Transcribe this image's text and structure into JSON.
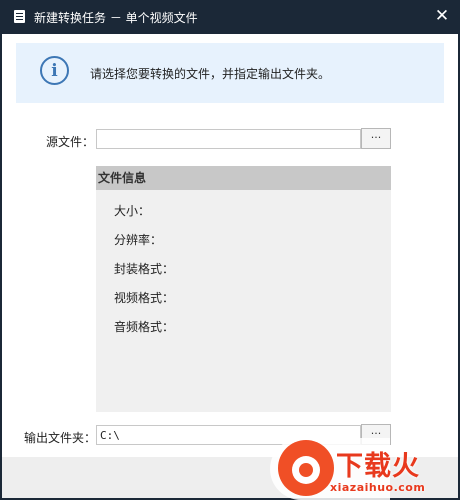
{
  "window": {
    "title": "新建转换任务 － 单个视频文件",
    "close_glyph": "✕"
  },
  "banner": {
    "icon_glyph": "i",
    "text": "请选择您要转换的文件，并指定输出文件夹。"
  },
  "source": {
    "label": "源文件：",
    "value": "",
    "browse_label": "···"
  },
  "file_info": {
    "header": "文件信息",
    "rows": [
      "大小：",
      "分辨率：",
      "封装格式：",
      "视频格式：",
      "音频格式："
    ]
  },
  "output": {
    "label": "输出文件夹：",
    "value": "C:\\",
    "browse_label": "···"
  },
  "watermark": {
    "brand": "下载火",
    "url": "xiazaihuo.com"
  },
  "colors": {
    "titlebar": "#1b2837",
    "banner_bg": "#e7f2fd",
    "info_icon": "#3d77b5",
    "panel_header": "#c8c8c8",
    "panel_bg": "#f0f0f0",
    "brand": "#e8391d"
  },
  "icons": {
    "title": "document-icon",
    "close": "close-icon",
    "info": "info-icon",
    "brand_logo": "fire-logo-icon"
  }
}
